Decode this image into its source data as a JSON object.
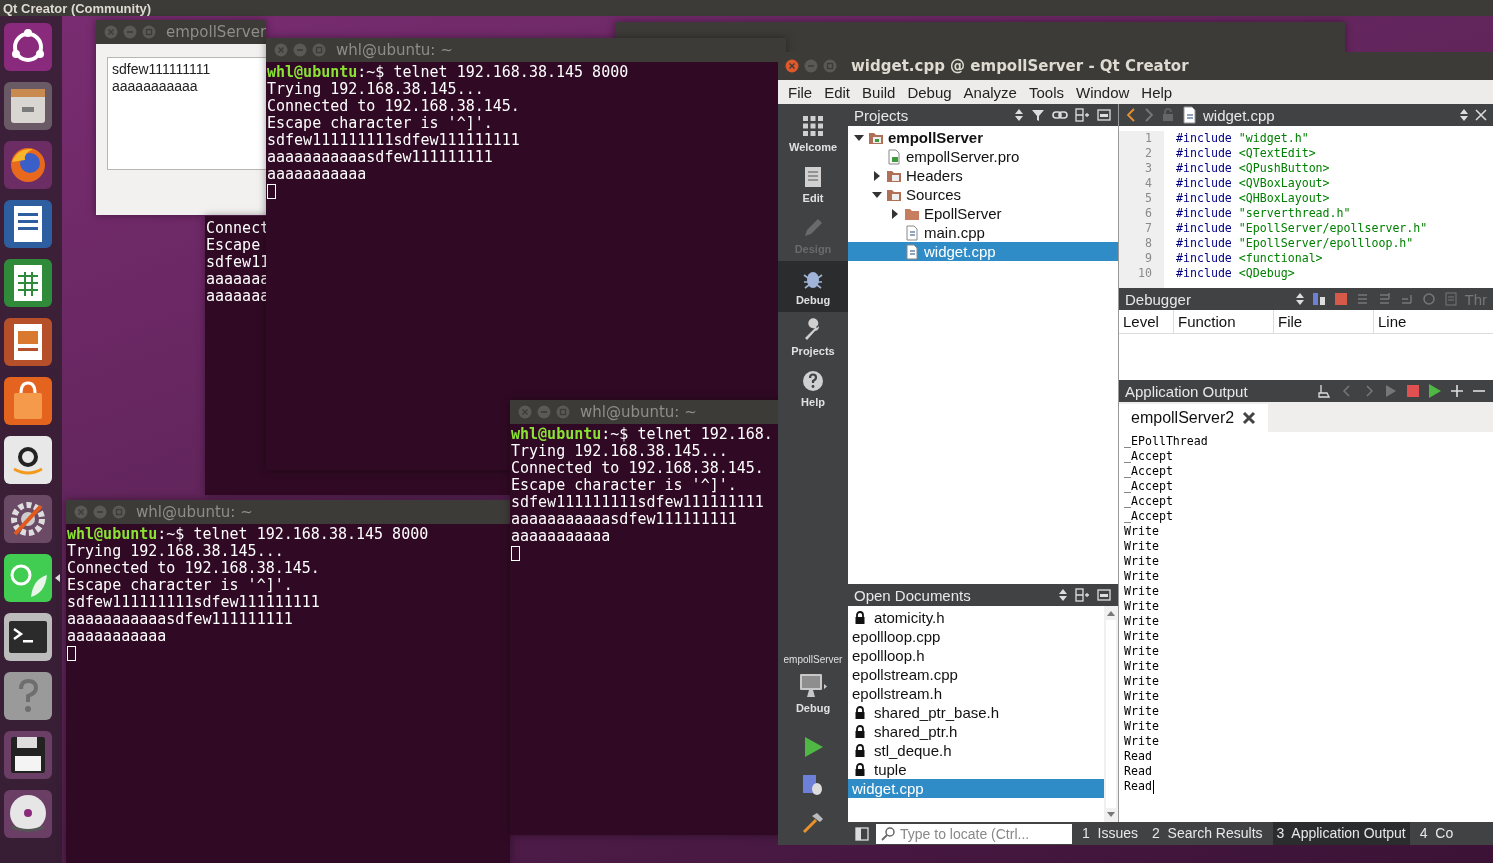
{
  "top_bar": {
    "title": "Qt Creator (Community)"
  },
  "launcher": [
    {
      "kind": "ubuntu",
      "focused": false
    },
    {
      "kind": "files",
      "focused": false
    },
    {
      "kind": "browser",
      "focused": false
    },
    {
      "kind": "writer",
      "focused": false
    },
    {
      "kind": "calc",
      "focused": false
    },
    {
      "kind": "impress",
      "focused": false
    },
    {
      "kind": "store",
      "focused": false
    },
    {
      "kind": "amazon",
      "focused": false
    },
    {
      "kind": "settings",
      "focused": false
    },
    {
      "kind": "qt",
      "focused": true
    },
    {
      "kind": "terminal",
      "focused": false
    },
    {
      "kind": "help",
      "focused": false
    },
    {
      "kind": "floppy",
      "focused": false
    },
    {
      "kind": "dvd",
      "focused": false
    }
  ],
  "windows": [
    {
      "kind": "frame"
    },
    {
      "kind": "app",
      "title": "empollServer",
      "text_lines": [
        "sdfew111111111",
        "aaaaaaaaaaa"
      ]
    },
    {
      "kind": "terminal",
      "lines": [
        "Connect",
        "Escape",
        "sdfew11",
        "aaaaaaa",
        "aaaaaaa"
      ]
    },
    {
      "kind": "terminal",
      "title": "whl@ubuntu: ~",
      "user": "whl@ubuntu",
      "path": ":~$",
      "command": "telnet 192.168.38.145 8000",
      "lines": [
        "Trying 192.168.38.145...",
        "Connected to 192.168.38.145.",
        "Escape character is '^]'.",
        "sdfew111111111sdfew111111111",
        "aaaaaaaaaaasdfew111111111",
        "aaaaaaaaaaa"
      ],
      "cursor": true
    },
    {
      "kind": "terminal",
      "title": "whl@ubuntu: ~",
      "user": "whl@ubuntu",
      "path": ":~$",
      "command": "telnet 192.168.38.145 8000",
      "lines": [
        "Trying 192.168.38.145...",
        "Connected to 192.168.38.145.",
        "Escape character is '^]'.",
        "sdfew111111111sdfew111111111",
        "aaaaaaaaaaasdfew111111111",
        "aaaaaaaaaaa"
      ],
      "cursor": true
    },
    {
      "kind": "terminal",
      "title": "whl@ubuntu: ~",
      "user": "whl@ubuntu",
      "path": ":~$",
      "command": "telnet 192.168.",
      "lines": [
        "Trying 192.168.38.145...",
        "Connected to 192.168.38.145.",
        "Escape character is '^]'.",
        "sdfew111111111sdfew111111111",
        "aaaaaaaaaaasdfew111111111",
        "aaaaaaaaaaa"
      ],
      "cursor": true
    }
  ],
  "qt_creator": {
    "title": "widget.cpp @ empollServer - Qt Creator",
    "menu": [
      "File",
      "Edit",
      "Build",
      "Debug",
      "Analyze",
      "Tools",
      "Window",
      "Help"
    ],
    "modes": [
      {
        "label": "Welcome",
        "kind": "welcome",
        "selected": false,
        "disabled": false
      },
      {
        "label": "Edit",
        "kind": "edit",
        "selected": false,
        "disabled": false
      },
      {
        "label": "Design",
        "kind": "design",
        "selected": false,
        "disabled": true
      },
      {
        "label": "Debug",
        "kind": "debug",
        "selected": true,
        "disabled": false
      },
      {
        "label": "Projects",
        "kind": "projects",
        "selected": false,
        "disabled": false
      },
      {
        "label": "Help",
        "kind": "help",
        "selected": false,
        "disabled": false
      }
    ],
    "target": {
      "project": "empollServer",
      "config": "Debug"
    },
    "projects": {
      "title": "Projects",
      "tree": [
        {
          "label": "empollServer",
          "kind": "project",
          "expanded": true,
          "selected": false,
          "children": [
            {
              "label": "empollServer.pro",
              "kind": "pro",
              "selected": false
            },
            {
              "label": "Headers",
              "kind": "headers",
              "expanded": false,
              "selected": false
            },
            {
              "label": "Sources",
              "kind": "sources",
              "expanded": true,
              "selected": false,
              "children": [
                {
                  "label": "EpollServer",
                  "kind": "folder",
                  "expanded": false,
                  "selected": false
                },
                {
                  "label": "main.cpp",
                  "kind": "cpp",
                  "selected": false
                },
                {
                  "label": "widget.cpp",
                  "kind": "cpp",
                  "selected": true
                }
              ]
            }
          ]
        }
      ]
    },
    "open_documents": {
      "title": "Open Documents",
      "items": [
        {
          "name": "atomicity.h",
          "locked": true,
          "selected": false
        },
        {
          "name": "epollloop.cpp",
          "locked": false,
          "selected": false
        },
        {
          "name": "epollloop.h",
          "locked": false,
          "selected": false
        },
        {
          "name": "epollstream.cpp",
          "locked": false,
          "selected": false
        },
        {
          "name": "epollstream.h",
          "locked": false,
          "selected": false
        },
        {
          "name": "shared_ptr_base.h",
          "locked": true,
          "selected": false
        },
        {
          "name": "shared_ptr.h",
          "locked": true,
          "selected": false
        },
        {
          "name": "stl_deque.h",
          "locked": true,
          "selected": false
        },
        {
          "name": "tuple",
          "locked": true,
          "selected": false
        },
        {
          "name": "widget.cpp",
          "locked": false,
          "selected": true
        }
      ]
    },
    "editor": {
      "file": "widget.cpp",
      "lines": [
        {
          "number": "1",
          "directive": "#include",
          "target": "\"widget.h\""
        },
        {
          "number": "2",
          "directive": "#include",
          "target": "<QTextEdit>"
        },
        {
          "number": "3",
          "directive": "#include",
          "target": "<QPushButton>"
        },
        {
          "number": "4",
          "directive": "#include",
          "target": "<QVBoxLayout>"
        },
        {
          "number": "5",
          "directive": "#include",
          "target": "<QHBoxLayout>"
        },
        {
          "number": "6",
          "directive": "#include",
          "target": "\"serverthread.h\""
        },
        {
          "number": "7",
          "directive": "#include",
          "target": "\"EpollServer/epollserver.h\""
        },
        {
          "number": "8",
          "directive": "#include",
          "target": "\"EpollServer/epollloop.h\""
        },
        {
          "number": "9",
          "directive": "#include",
          "target": "<functional>"
        },
        {
          "number": "10",
          "directive": "#include",
          "target": "<QDebug>"
        }
      ]
    },
    "debugger": {
      "title": "Debugger",
      "toolbar_text": "Thr",
      "columns": [
        "Level",
        "Function",
        "File",
        "Line"
      ]
    },
    "output": {
      "title": "Application Output",
      "tabs": [
        {
          "label": "empollServer2",
          "selected": true
        }
      ],
      "lines": [
        "_EPollThread",
        "_Accept",
        "_Accept",
        "_Accept",
        "_Accept",
        "_Accept",
        "Write",
        "Write",
        "Write",
        "Write",
        "Write",
        "Write",
        "Write",
        "Write",
        "Write",
        "Write",
        "Write",
        "Write",
        "Write",
        "Write",
        "Write",
        "Read",
        "Read",
        "Read"
      ]
    },
    "bottom_bar": {
      "locate_placeholder": "Type to locate (Ctrl...",
      "panes": [
        {
          "number": "1",
          "label": "Issues",
          "selected": false
        },
        {
          "number": "2",
          "label": "Search Results",
          "selected": false
        },
        {
          "number": "3",
          "label": "Application Output",
          "selected": true
        },
        {
          "number": "4",
          "label": "Co",
          "selected": false
        }
      ]
    }
  }
}
